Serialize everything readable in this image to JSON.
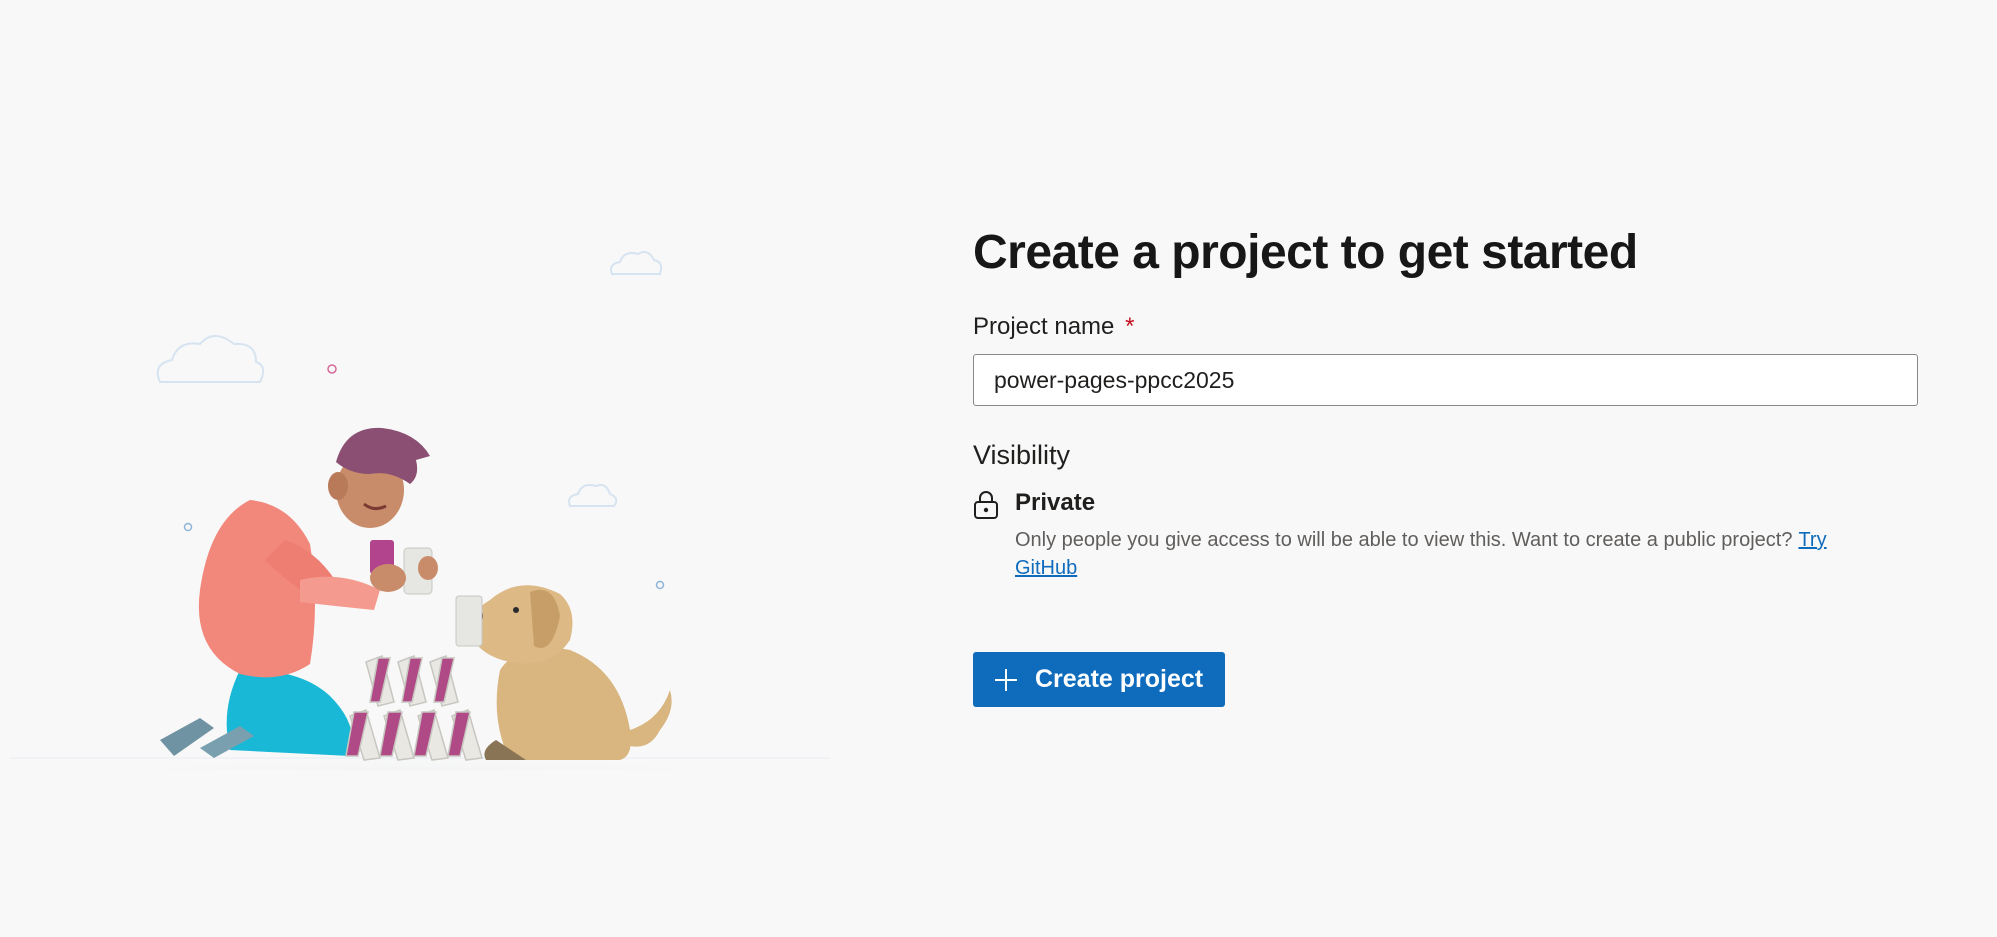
{
  "form": {
    "title": "Create a project to get started",
    "project_name_label": "Project name",
    "required_marker": "*",
    "project_name_value": "power-pages-ppcc2025"
  },
  "visibility": {
    "heading": "Visibility",
    "option_title": "Private",
    "option_description": "Only people you give access to will be able to view this. Want to create a public project?",
    "option_link": "Try GitHub",
    "icon": "lock-icon"
  },
  "actions": {
    "create_label": "Create project",
    "create_icon": "plus-icon"
  },
  "colors": {
    "background": "#f8f8f8",
    "accent": "#0f6cbd",
    "required": "#c50f1f"
  }
}
